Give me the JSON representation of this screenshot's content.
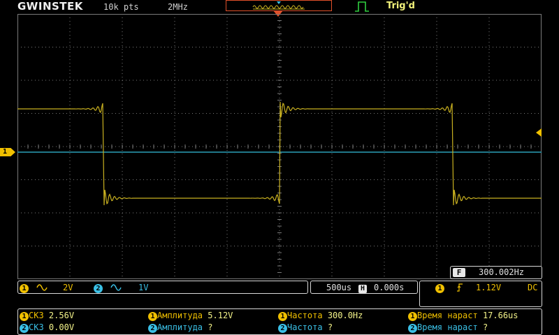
{
  "header": {
    "brand": "GWINSTEK",
    "record_length": "10k pts",
    "sample_rate": "2MHz",
    "trigger_status": "Trig'd"
  },
  "icons": {
    "waveform_overview": "memory-overview-icon",
    "trigger_pulse": "pulse-edge-icon",
    "trigger_position": "trigger-position-marker-icon",
    "ac_coupling": "ac-coupling-icon",
    "rising_edge": "rising-edge-icon"
  },
  "colors": {
    "ch1": "#f0c000",
    "ch1_trace": "#c8b020",
    "ch2": "#3ac0e6",
    "ch2_trace": "#2aa0b8",
    "accent_orange": "#e0502a",
    "trig_text": "#f2f27a",
    "grid": "#7a7a7a"
  },
  "channel_marker": "1",
  "frequency_counter": {
    "badge": "F",
    "value": "300.002Hz"
  },
  "channels": [
    {
      "num": "1",
      "scale": "2V"
    },
    {
      "num": "2",
      "scale": "1V"
    }
  ],
  "timebase": {
    "scale": "500us",
    "h_badge": "H",
    "position": "0.000s"
  },
  "trigger": {
    "source": "1",
    "level": "1.12V",
    "coupling": "DC"
  },
  "measurements": {
    "row1": [
      {
        "src": "1",
        "label": "СКЗ",
        "value": "2.56V"
      },
      {
        "src": "1",
        "label": "Амплитуда",
        "value": "5.12V"
      },
      {
        "src": "1",
        "label": "Частота",
        "value": "300.0Hz"
      },
      {
        "src": "1",
        "label": "Время нараст",
        "value": "17.66us"
      }
    ],
    "row2": [
      {
        "src": "2",
        "label": "СКЗ",
        "value": "0.00V"
      },
      {
        "src": "2",
        "label": "Амплитуда",
        "value": "?"
      },
      {
        "src": "2",
        "label": "Частота",
        "value": "?"
      },
      {
        "src": "2",
        "label": "Время нараст",
        "value": "?"
      }
    ]
  }
}
